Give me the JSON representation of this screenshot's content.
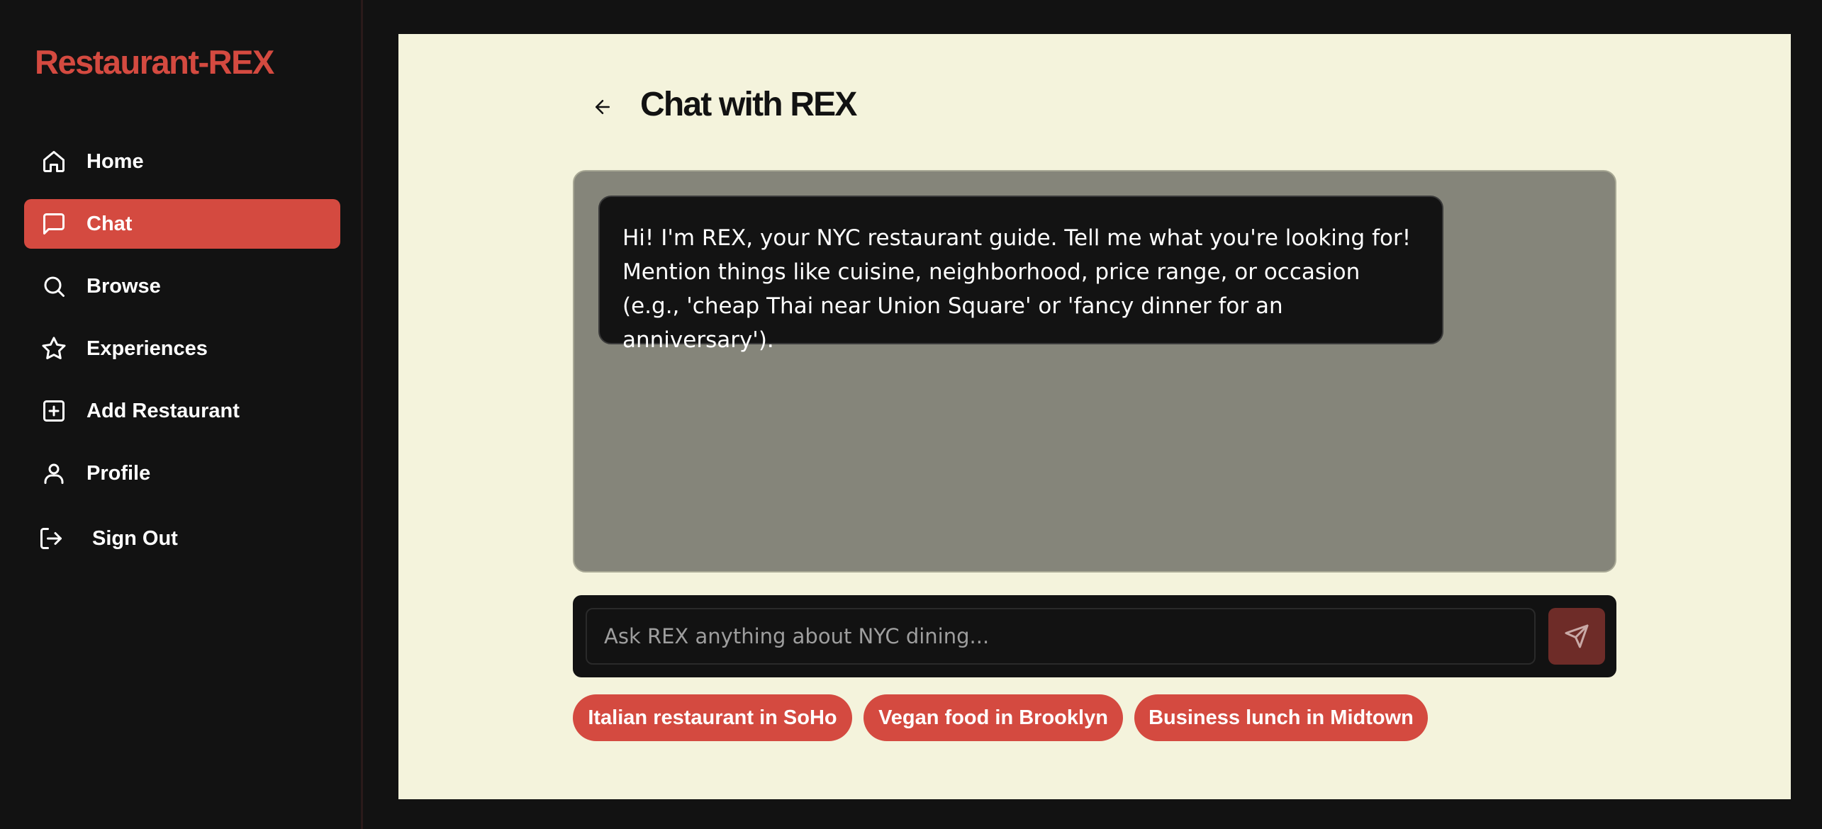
{
  "app": {
    "brand": "Restaurant-REX"
  },
  "sidebar": {
    "items": [
      {
        "label": "Home",
        "icon": "home-icon",
        "active": false
      },
      {
        "label": "Chat",
        "icon": "message-square-icon",
        "active": true
      },
      {
        "label": "Browse",
        "icon": "search-icon",
        "active": false
      },
      {
        "label": "Experiences",
        "icon": "star-icon",
        "active": false
      },
      {
        "label": "Add Restaurant",
        "icon": "plus-square-icon",
        "active": false
      },
      {
        "label": "Profile",
        "icon": "user-icon",
        "active": false
      },
      {
        "label": "Sign Out",
        "icon": "log-out-icon",
        "active": false
      }
    ]
  },
  "page": {
    "title": "Chat with REX",
    "back_icon": "arrow-left-icon"
  },
  "chat": {
    "messages": [
      {
        "sender": "REX",
        "text": "Hi! I'm REX, your NYC restaurant guide. Tell me what you're looking for! Mention things like cuisine, neighborhood, price range, or occasion (e.g., 'cheap Thai near Union Square' or 'fancy dinner for an anniversary')."
      }
    ]
  },
  "composer": {
    "placeholder": "Ask REX anything about NYC dining...",
    "value": "",
    "send_icon": "send-icon"
  },
  "suggestions": [
    "Italian restaurant in SoHo",
    "Vegan food in Brooklyn",
    "Business lunch in Midtown"
  ],
  "colors": {
    "accent": "#d44a40",
    "background": "#121212",
    "panel": "#f4f3dc",
    "chat_area": "#85857a",
    "send_button": "#6e2c28"
  }
}
